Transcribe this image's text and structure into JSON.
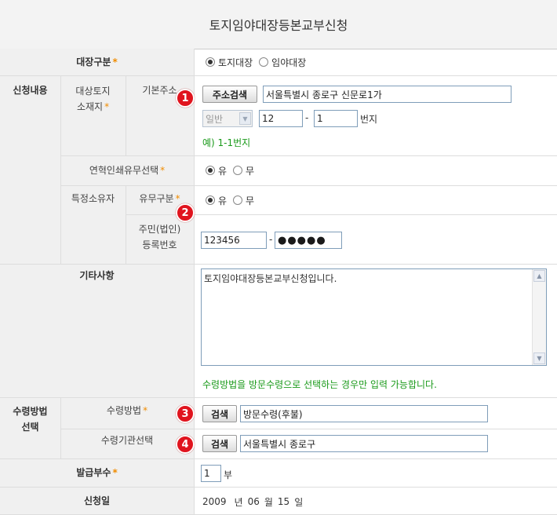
{
  "title": "토지임야대장등본교부신청",
  "ledger_type": {
    "label": "대장구분",
    "required_mark": "*",
    "options": [
      {
        "label": "토지대장",
        "selected": true
      },
      {
        "label": "임야대장",
        "selected": false
      }
    ]
  },
  "application": {
    "section_label": "신청내용",
    "location_label_1": "대상토지",
    "location_label_2": "소재지",
    "required_mark": "*",
    "address_label": "기본주소",
    "address_search_button": "주소검색",
    "address_value": "서울특별시 종로구 신문로1가",
    "land_type_select": "일반",
    "lot_main": "12",
    "lot_dash": "-",
    "lot_sub": "1",
    "lot_unit": "번지",
    "example_text": "예) 1-1번지",
    "history_label": "연혁인쇄유무선택",
    "history_options": [
      {
        "label": "유",
        "selected": true
      },
      {
        "label": "무",
        "selected": false
      }
    ],
    "owner_label": "특정소유자",
    "owner_type_label": "유무구분",
    "owner_options": [
      {
        "label": "유",
        "selected": true
      },
      {
        "label": "무",
        "selected": false
      }
    ],
    "id_label_1": "주민(법인)",
    "id_label_2": "등록번호",
    "id_front": "123456",
    "id_dash": "-",
    "id_back": "●●●●●"
  },
  "other": {
    "label": "기타사항",
    "text": "토지임야대장등본교부신청입니다.",
    "notice": "수령방법을 방문수령으로 선택하는 경우만 입력 가능합니다."
  },
  "receipt": {
    "section_label_1": "수령방법",
    "section_label_2": "선택",
    "method_label": "수령방법",
    "required_mark": "*",
    "search_button": "검색",
    "method_value": "방문수령(후불)",
    "agency_label": "수령기관선택",
    "agency_value": "서울특별시 종로구"
  },
  "copies": {
    "label": "발급부수",
    "required_mark": "*",
    "value": "1",
    "unit": "부"
  },
  "date": {
    "label": "신청일",
    "year": "2009",
    "year_unit": "년",
    "month": "06",
    "month_unit": "월",
    "day": "15",
    "day_unit": "일"
  },
  "badges": [
    "1",
    "2",
    "3",
    "4"
  ],
  "colors": {
    "required": "#f08c00",
    "badge": "#e0141e",
    "notice": "#1a9a1a"
  }
}
